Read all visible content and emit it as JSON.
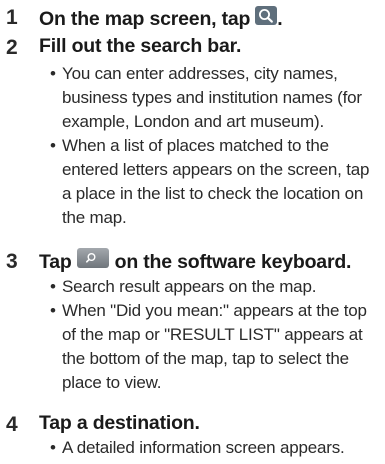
{
  "steps": [
    {
      "number": "1",
      "title_before": "On the map screen, tap",
      "title_after": ".",
      "icon": "search-icon",
      "bullets": []
    },
    {
      "number": "2",
      "title": "Fill out the search bar.",
      "bullets": [
        "You can enter addresses, city names, business types and institution names (for example, London and art museum).",
        "When a list of places matched to the entered letters appears on the screen, tap a place in the list to check the location on the map."
      ]
    },
    {
      "number": "3",
      "title_before": "Tap",
      "title_after": "on the software keyboard.",
      "icon": "keyboard-search-key-icon",
      "bullets": [
        "Search result appears on the map.",
        "When \"Did you mean:\" appears at the top of the map or \"RESULT LIST\" appears at the bottom of the map, tap to select the place to view."
      ]
    },
    {
      "number": "4",
      "title": "Tap a destination.",
      "bullets": [
        "A detailed information screen appears."
      ]
    }
  ],
  "bullet_symbol": "•"
}
